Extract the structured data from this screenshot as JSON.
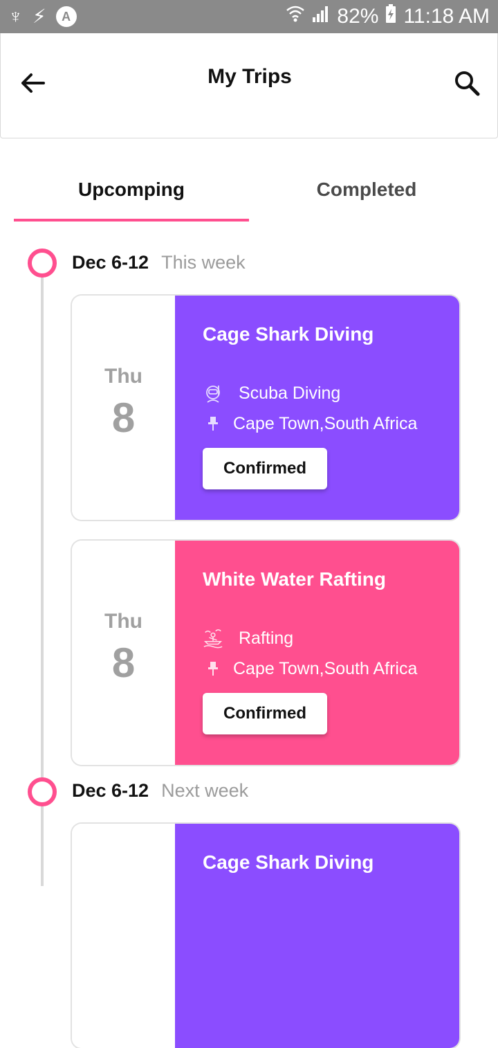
{
  "statusbar": {
    "battery": "82%",
    "time": "11:18 AM",
    "notif_icon": "A"
  },
  "header": {
    "title": "My Trips"
  },
  "tabs": {
    "upcoming": "Upcomping",
    "completed": "Completed"
  },
  "weeks": [
    {
      "range": "Dec 6-12",
      "relative": "This week"
    },
    {
      "range": "Dec 6-12",
      "relative": "Next week"
    }
  ],
  "cards": [
    {
      "day": "Thu",
      "date": "8",
      "title": "Cage Shark Diving",
      "activity": "Scuba Diving",
      "location": "Cape Town,South Africa",
      "status": "Confirmed",
      "color": "#8b4dff"
    },
    {
      "day": "Thu",
      "date": "8",
      "title": "White Water Rafting",
      "activity": "Rafting",
      "location": "Cape Town,South Africa",
      "status": "Confirmed",
      "color": "#ff4f8f"
    },
    {
      "title": "Cage Shark Diving",
      "color": "#8b4dff"
    }
  ],
  "colors": {
    "accent": "#ff4f8f",
    "purple": "#8b4dff",
    "statusbar": "#8a8a8a"
  },
  "icons": {
    "back": "arrow-left-icon",
    "search": "search-icon",
    "activity_diving": "scuba-diver-icon",
    "activity_rafting": "rafting-icon",
    "location": "pin-icon"
  }
}
